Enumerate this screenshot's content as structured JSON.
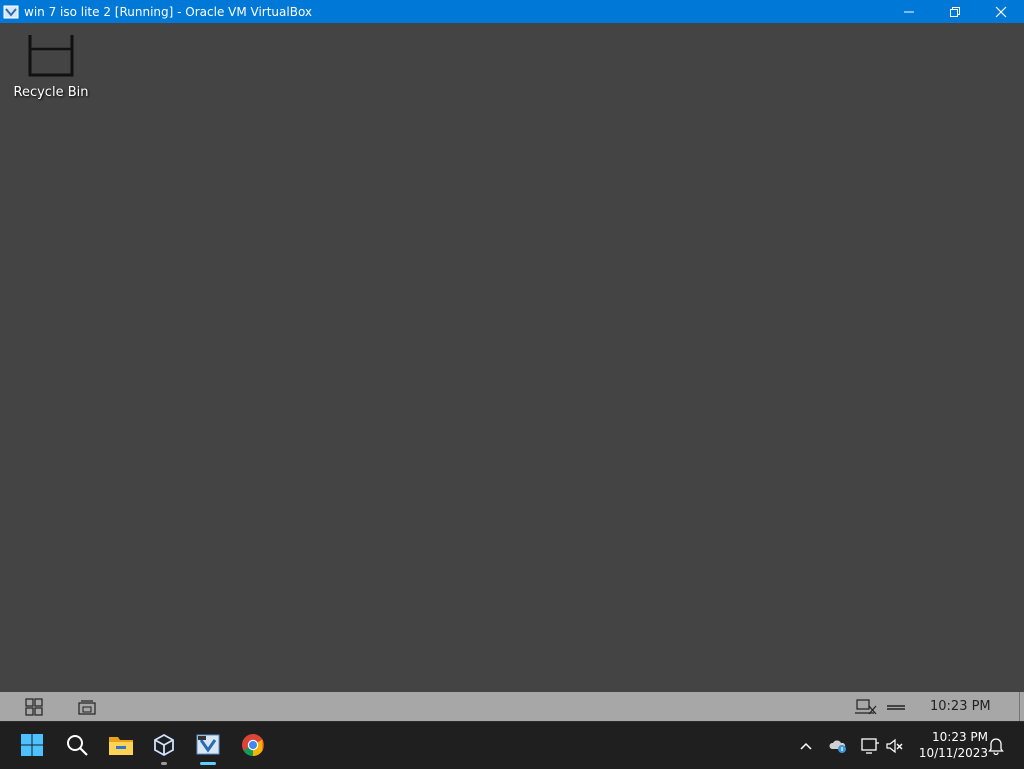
{
  "window": {
    "title": "win 7 iso lite 2 [Running] - Oracle VM VirtualBox",
    "controls": [
      "minimize-icon",
      "restore-icon",
      "close-icon"
    ]
  },
  "desktop": {
    "icons": [
      {
        "label": "Recycle Bin",
        "icon": "recycle-bin-icon"
      }
    ]
  },
  "guest_taskbar": {
    "buttons": [
      "start-grid-icon",
      "show-desktop-icon"
    ],
    "tray": [
      "network-icon",
      "volume-icon"
    ],
    "clock": "10:23 PM"
  },
  "host_taskbar": {
    "pinned": [
      {
        "name": "start",
        "icon": "windows-start-icon"
      },
      {
        "name": "search",
        "icon": "search-icon"
      },
      {
        "name": "file-explorer",
        "icon": "folder-icon"
      },
      {
        "name": "virtualbox-manager",
        "icon": "virtualbox-icon"
      },
      {
        "name": "virtualbox-vm",
        "icon": "virtualbox-vm-icon",
        "active": true
      },
      {
        "name": "chrome",
        "icon": "chrome-icon"
      }
    ],
    "tray": [
      "chevron-up-icon",
      "onedrive-icon",
      "display-icon",
      "volume-muted-icon"
    ],
    "clock": {
      "time": "10:23 PM",
      "date": "10/11/2023"
    },
    "notifications_icon": "bell-icon"
  },
  "colors": {
    "titlebar": "#0078d7",
    "desktop": "#444444",
    "guest_taskbar": "#a7a7a7",
    "host_taskbar": "#1f1f1f",
    "accent": "#60cdff"
  }
}
